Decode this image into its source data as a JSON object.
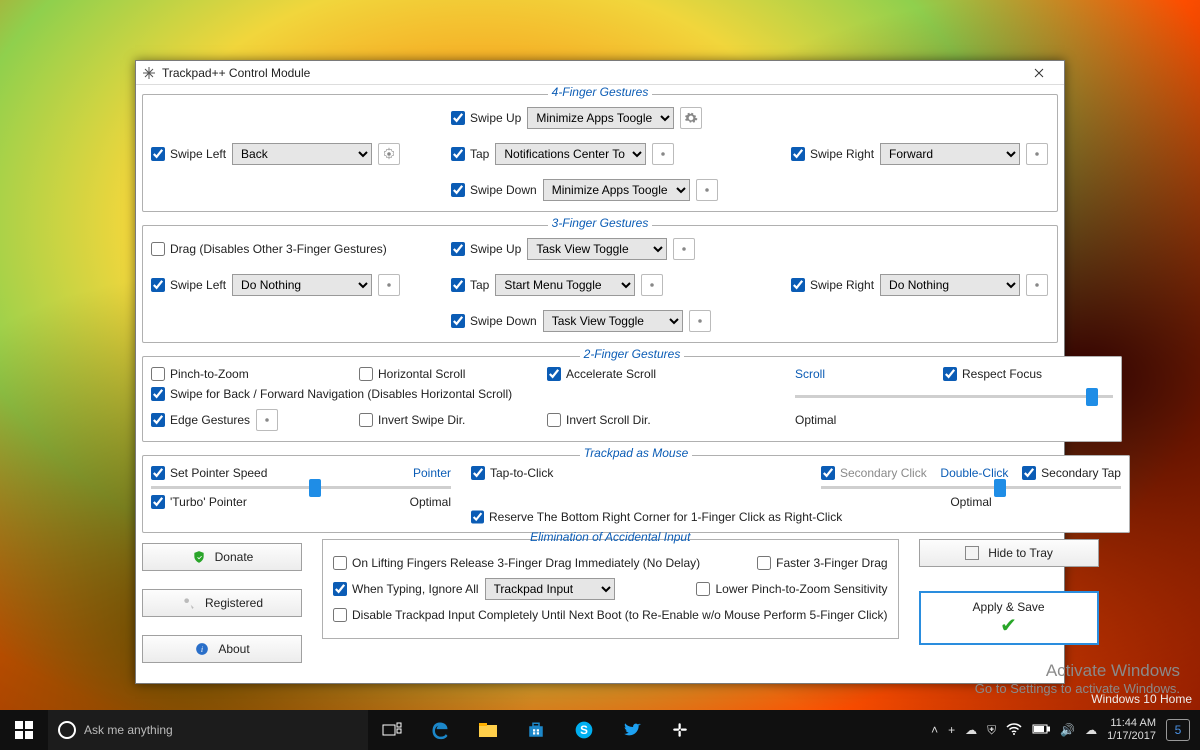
{
  "window": {
    "title": "Trackpad++ Control Module"
  },
  "groups": {
    "g4": {
      "title": "4-Finger Gestures",
      "swipeLeft": {
        "label": "Swipe Left",
        "value": "Back",
        "checked": true
      },
      "swipeUp": {
        "label": "Swipe Up",
        "value": "Minimize Apps Toogle",
        "checked": true
      },
      "tap": {
        "label": "Tap",
        "value": "Notifications Center To",
        "checked": true
      },
      "swipeDown": {
        "label": "Swipe Down",
        "value": "Minimize Apps Toogle",
        "checked": true
      },
      "swipeRight": {
        "label": "Swipe Right",
        "value": "Forward",
        "checked": true
      }
    },
    "g3": {
      "title": "3-Finger Gestures",
      "drag": {
        "label": "Drag (Disables Other 3-Finger Gestures)",
        "checked": false
      },
      "swipeLeft": {
        "label": "Swipe Left",
        "value": "Do Nothing",
        "checked": true
      },
      "swipeUp": {
        "label": "Swipe Up",
        "value": "Task View Toggle",
        "checked": true
      },
      "tap": {
        "label": "Tap",
        "value": "Start Menu Toggle",
        "checked": true
      },
      "swipeDown": {
        "label": "Swipe Down",
        "value": "Task View Toggle",
        "checked": true
      },
      "swipeRight": {
        "label": "Swipe Right",
        "value": "Do Nothing",
        "checked": true
      }
    },
    "g2": {
      "title": "2-Finger Gestures",
      "pinch": {
        "label": "Pinch-to-Zoom",
        "checked": false
      },
      "hscroll": {
        "label": "Horizontal Scroll",
        "checked": false
      },
      "accel": {
        "label": "Accelerate Scroll",
        "checked": true
      },
      "scrollLink": "Scroll",
      "respect": {
        "label": "Respect Focus",
        "checked": true
      },
      "swipeNav": {
        "label": "Swipe for Back / Forward Navigation (Disables Horizontal Scroll)",
        "checked": true
      },
      "edge": {
        "label": "Edge Gestures",
        "checked": true
      },
      "invSwipe": {
        "label": "Invert Swipe Dir.",
        "checked": false
      },
      "invScroll": {
        "label": "Invert Scroll Dir.",
        "checked": false
      },
      "optimal": "Optimal"
    },
    "tm": {
      "title": "Trackpad as Mouse",
      "setSpeed": {
        "label": "Set Pointer Speed",
        "checked": true
      },
      "pointerLink": "Pointer",
      "tapClick": {
        "label": "Tap-to-Click",
        "checked": true
      },
      "secClick": {
        "label": "Secondary Click",
        "checked": true
      },
      "dblLink": "Double-Click",
      "secTap": {
        "label": "Secondary Tap",
        "checked": true
      },
      "turbo": {
        "label": "'Turbo' Pointer",
        "checked": true
      },
      "optimal": "Optimal",
      "reserve": {
        "label": "Reserve The Bottom Right Corner for 1-Finger Click as Right-Click",
        "checked": true
      },
      "optimal2": "Optimal"
    },
    "eai": {
      "title": "Elimination of Accidental Input",
      "releaseDrag": {
        "label": "On Lifting Fingers Release 3-Finger Drag Immediately (No Delay)",
        "checked": false
      },
      "fasterDrag": {
        "label": "Faster 3-Finger Drag",
        "checked": false
      },
      "ignore": {
        "label": "When Typing, Ignore All",
        "checked": true,
        "value": "Trackpad Input"
      },
      "lowerPinch": {
        "label": "Lower Pinch-to-Zoom Sensitivity",
        "checked": false
      },
      "disableBoot": {
        "label": "Disable Trackpad Input Completely Until Next Boot (to Re-Enable w/o Mouse Perform 5-Finger Click)",
        "checked": false
      }
    }
  },
  "buttons": {
    "donate": "Donate",
    "registered": "Registered",
    "about": "About",
    "hideTray": "Hide to Tray",
    "apply": "Apply & Save"
  },
  "watermark": {
    "line1": "Activate Windows",
    "line2": "Go to Settings to activate Windows.",
    "edition": "Windows 10 Home"
  },
  "taskbar": {
    "searchPlaceholder": "Ask me anything",
    "time": "11:44 AM",
    "date": "1/17/2017",
    "notifCount": "5"
  }
}
